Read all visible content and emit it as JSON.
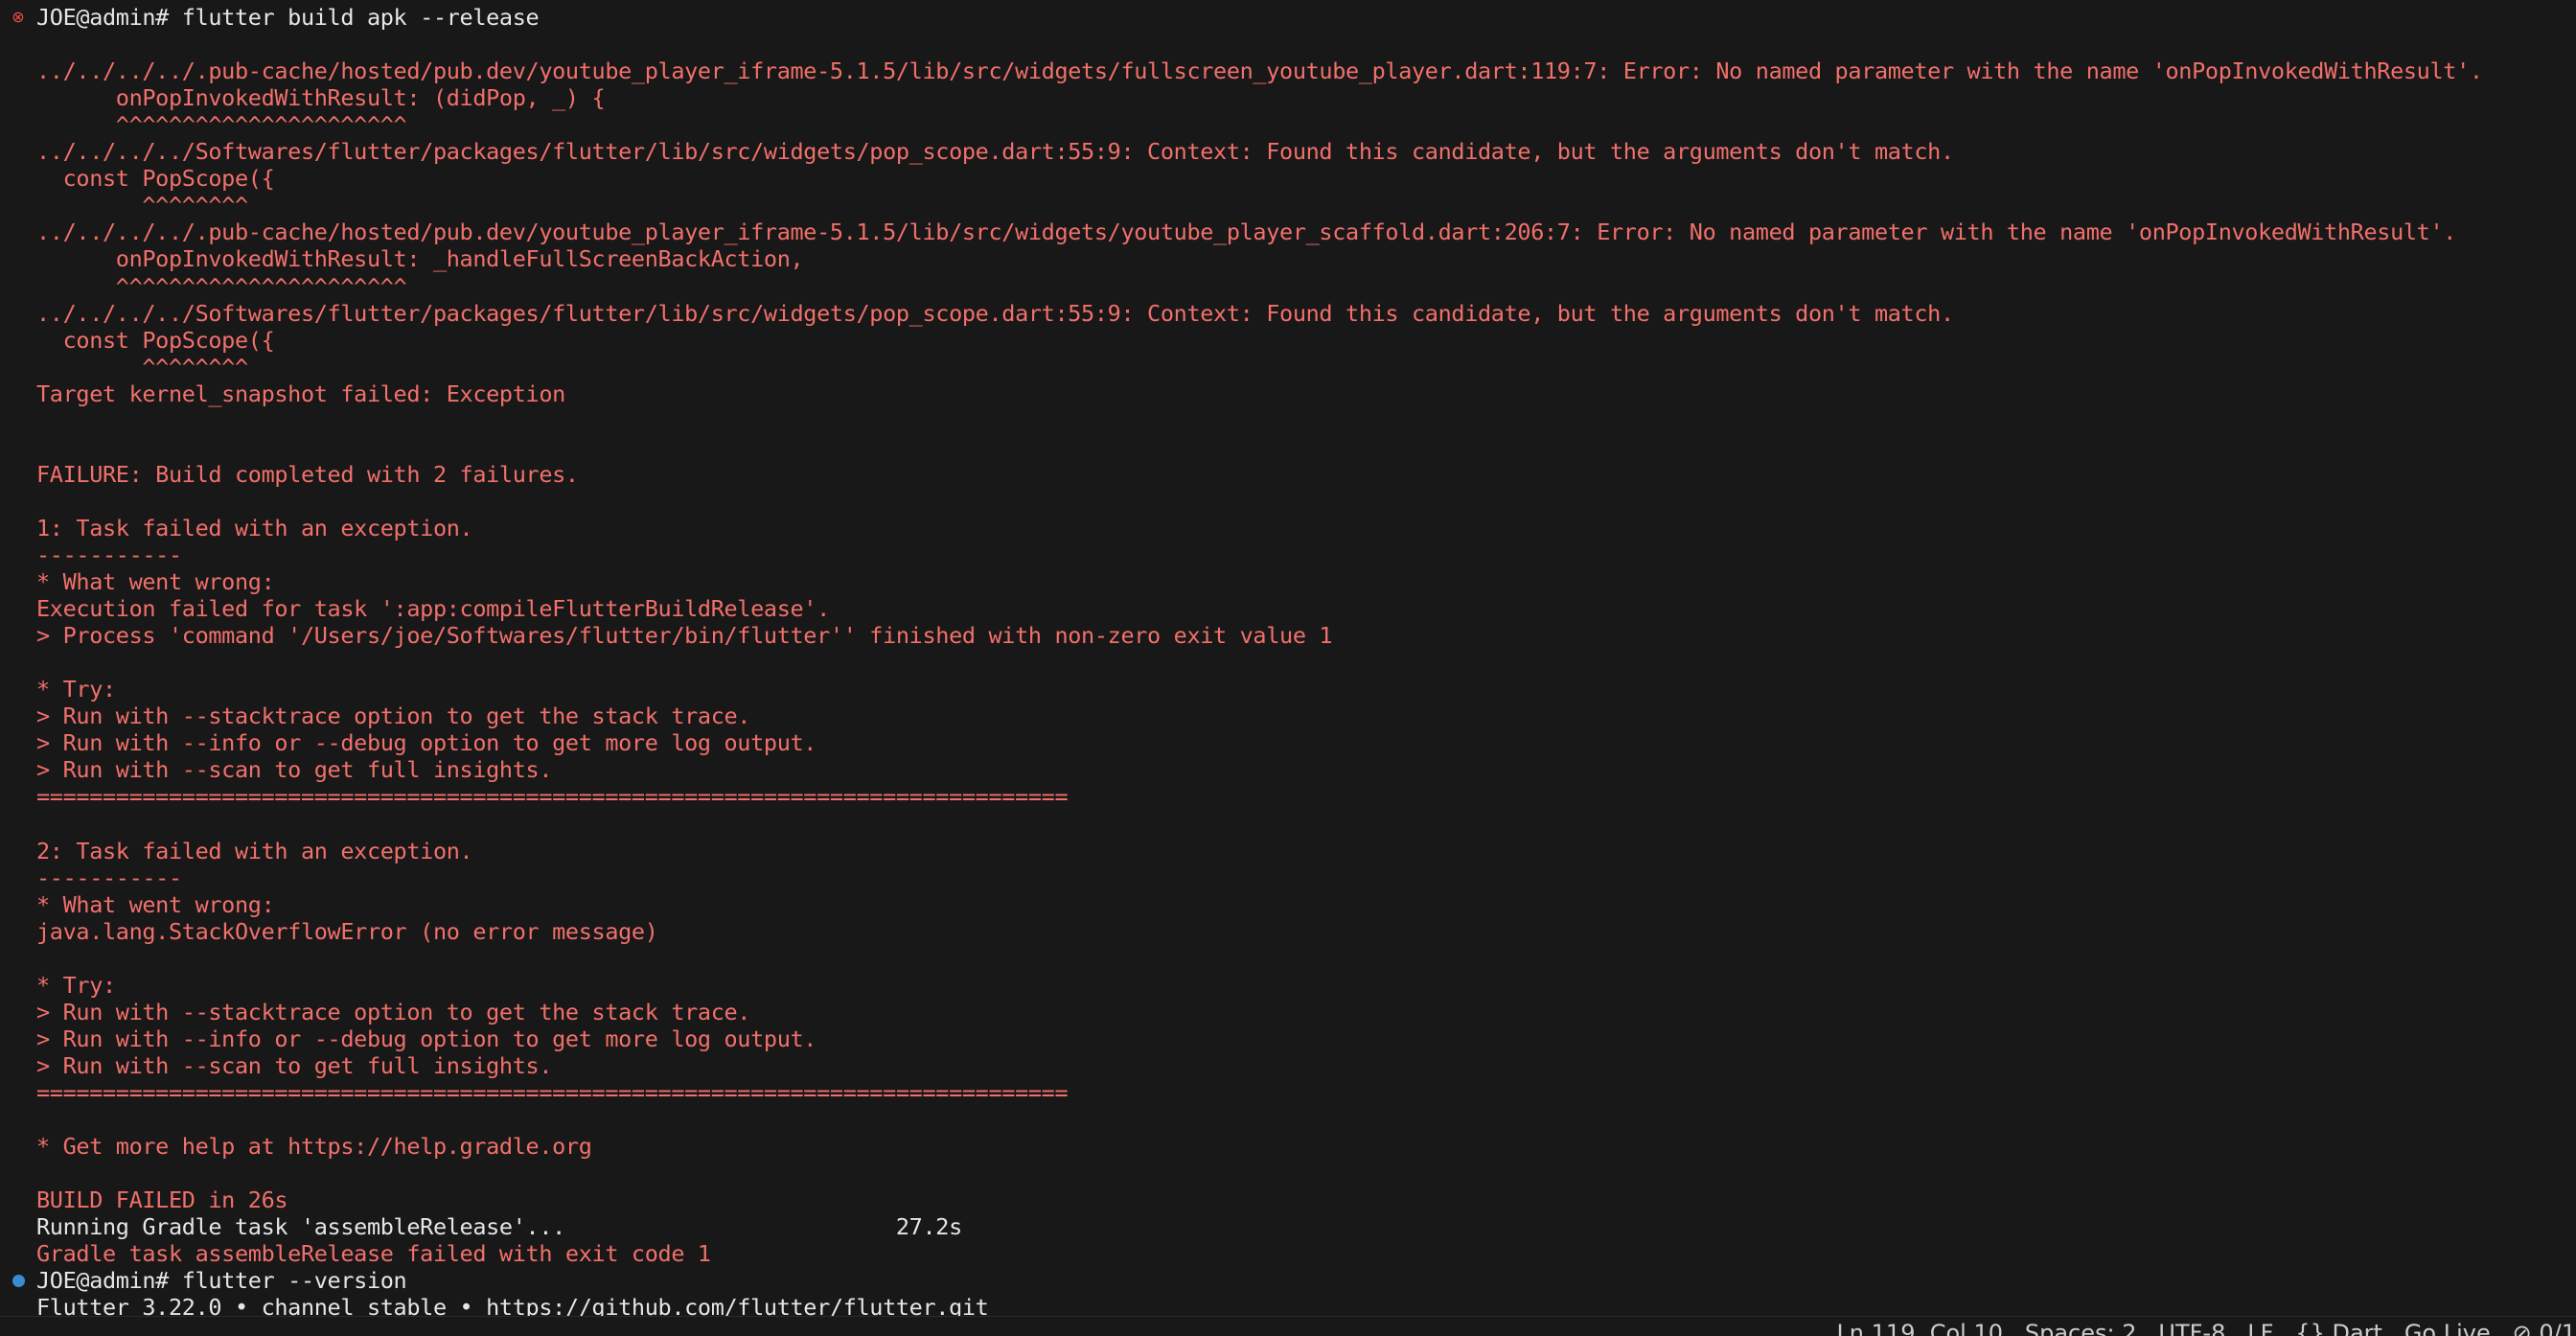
{
  "terminal": {
    "lines": [
      {
        "text": "JOE@admin# flutter build apk --release",
        "color": "white"
      },
      {
        "text": "",
        "color": "red"
      },
      {
        "text": "../../../../.pub-cache/hosted/pub.dev/youtube_player_iframe-5.1.5/lib/src/widgets/fullscreen_youtube_player.dart:119:7: Error: No named parameter with the name 'onPopInvokedWithResult'.",
        "color": "red"
      },
      {
        "text": "      onPopInvokedWithResult: (didPop, _) {",
        "color": "red"
      },
      {
        "text": "      ^^^^^^^^^^^^^^^^^^^^^^",
        "color": "red"
      },
      {
        "text": "../../../../Softwares/flutter/packages/flutter/lib/src/widgets/pop_scope.dart:55:9: Context: Found this candidate, but the arguments don't match.",
        "color": "red"
      },
      {
        "text": "  const PopScope({",
        "color": "red"
      },
      {
        "text": "        ^^^^^^^^",
        "color": "red"
      },
      {
        "text": "../../../../.pub-cache/hosted/pub.dev/youtube_player_iframe-5.1.5/lib/src/widgets/youtube_player_scaffold.dart:206:7: Error: No named parameter with the name 'onPopInvokedWithResult'.",
        "color": "red"
      },
      {
        "text": "      onPopInvokedWithResult: _handleFullScreenBackAction,",
        "color": "red"
      },
      {
        "text": "      ^^^^^^^^^^^^^^^^^^^^^^",
        "color": "red"
      },
      {
        "text": "../../../../Softwares/flutter/packages/flutter/lib/src/widgets/pop_scope.dart:55:9: Context: Found this candidate, but the arguments don't match.",
        "color": "red"
      },
      {
        "text": "  const PopScope({",
        "color": "red"
      },
      {
        "text": "        ^^^^^^^^",
        "color": "red"
      },
      {
        "text": "Target kernel_snapshot failed: Exception",
        "color": "red"
      },
      {
        "text": "",
        "color": "red"
      },
      {
        "text": "",
        "color": "red"
      },
      {
        "text": "FAILURE: Build completed with 2 failures.",
        "color": "red"
      },
      {
        "text": "",
        "color": "red"
      },
      {
        "text": "1: Task failed with an exception.",
        "color": "red"
      },
      {
        "text": "-----------",
        "color": "red"
      },
      {
        "text": "* What went wrong:",
        "color": "red"
      },
      {
        "text": "Execution failed for task ':app:compileFlutterBuildRelease'.",
        "color": "red"
      },
      {
        "text": "> Process 'command '/Users/joe/Softwares/flutter/bin/flutter'' finished with non-zero exit value 1",
        "color": "red"
      },
      {
        "text": "",
        "color": "red"
      },
      {
        "text": "* Try:",
        "color": "red"
      },
      {
        "text": "> Run with --stacktrace option to get the stack trace.",
        "color": "red"
      },
      {
        "text": "> Run with --info or --debug option to get more log output.",
        "color": "red"
      },
      {
        "text": "> Run with --scan to get full insights.",
        "color": "red"
      },
      {
        "text": "==============================================================================",
        "color": "red"
      },
      {
        "text": "",
        "color": "red"
      },
      {
        "text": "2: Task failed with an exception.",
        "color": "red"
      },
      {
        "text": "-----------",
        "color": "red"
      },
      {
        "text": "* What went wrong:",
        "color": "red"
      },
      {
        "text": "java.lang.StackOverflowError (no error message)",
        "color": "red"
      },
      {
        "text": "",
        "color": "red"
      },
      {
        "text": "* Try:",
        "color": "red"
      },
      {
        "text": "> Run with --stacktrace option to get the stack trace.",
        "color": "red"
      },
      {
        "text": "> Run with --info or --debug option to get more log output.",
        "color": "red"
      },
      {
        "text": "> Run with --scan to get full insights.",
        "color": "red"
      },
      {
        "text": "==============================================================================",
        "color": "red"
      },
      {
        "text": "",
        "color": "red"
      },
      {
        "text": "* Get more help at https://help.gradle.org",
        "color": "red"
      },
      {
        "text": "",
        "color": "red"
      },
      {
        "text": "BUILD FAILED in 26s",
        "color": "red"
      },
      {
        "text": "Running Gradle task 'assembleRelease'...                         27.2s",
        "color": "white"
      },
      {
        "text": "Gradle task assembleRelease failed with exit code 1",
        "color": "red"
      },
      {
        "text": "JOE@admin# flutter --version",
        "color": "white"
      },
      {
        "text": "Flutter 3.22.0 • channel stable • https://github.com/flutter/flutter.git",
        "color": "white"
      }
    ],
    "markers": [
      {
        "line": 0,
        "type": "error",
        "glyph": "⊗",
        "icon": "error-circle-icon"
      },
      {
        "line": 47,
        "type": "dot",
        "glyph": "",
        "icon": "command-success-dot-icon"
      }
    ]
  },
  "statusbar": {
    "text": "Ln 119, Col 10   Spaces: 2   UTF-8   LF   {} Dart   Go Live   ⊘ 0/1"
  },
  "colors": {
    "background": "#181818",
    "error_text": "#f1706b",
    "normal_text": "#e6e6e6",
    "error_marker": "#f14c4c",
    "success_marker": "#3a8bd0"
  }
}
